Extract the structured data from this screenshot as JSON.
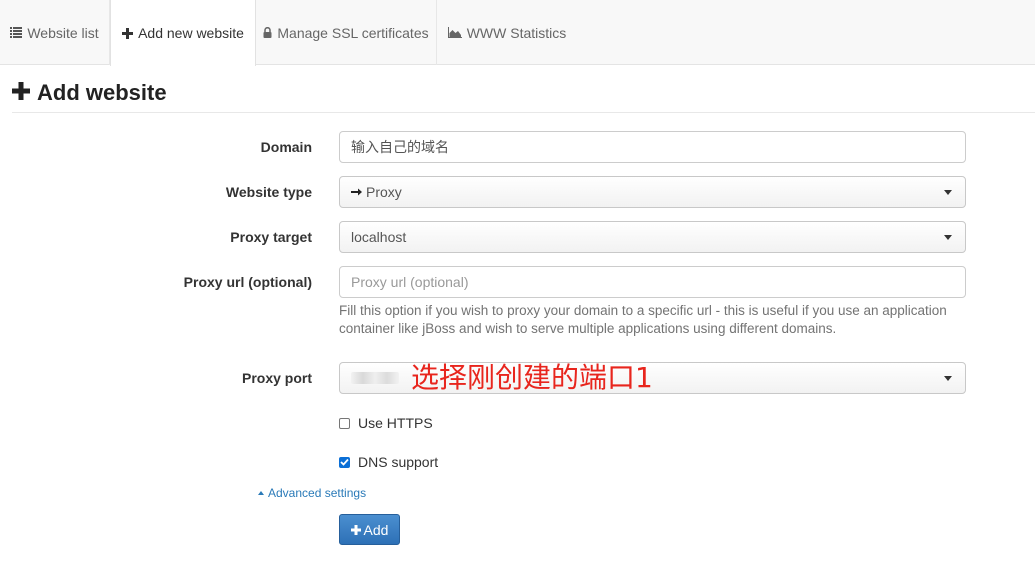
{
  "tabs": [
    {
      "label": "Website list",
      "icon": "list-icon"
    },
    {
      "label": "Add new website",
      "icon": "plus-icon"
    },
    {
      "label": "Manage SSL certificates",
      "icon": "lock-icon"
    },
    {
      "label": "WWW Statistics",
      "icon": "area-chart-icon"
    }
  ],
  "page": {
    "title": "Add website"
  },
  "form": {
    "domain": {
      "label": "Domain",
      "value": "输入自己的域名"
    },
    "website_type": {
      "label": "Website type",
      "value": "Proxy",
      "icon": "arrow-right-icon"
    },
    "proxy_target": {
      "label": "Proxy target",
      "value": "localhost"
    },
    "proxy_url": {
      "label": "Proxy url (optional)",
      "placeholder": "Proxy url (optional)",
      "help": "Fill this option if you wish to proxy your domain to a specific url - this is useful if you use an application container like jBoss and wish to serve multiple applications using different domains."
    },
    "proxy_port": {
      "label": "Proxy port",
      "annotation": "选择刚创建的端口1"
    },
    "use_https": {
      "label": "Use HTTPS",
      "checked": false
    },
    "dns_support": {
      "label": "DNS support",
      "checked": true
    },
    "advanced": {
      "label": "Advanced settings"
    },
    "add_button": {
      "label": "Add"
    }
  },
  "colors": {
    "accent": "#2d70b6",
    "annotation": "#e8251d",
    "link": "#2a7ab8"
  }
}
